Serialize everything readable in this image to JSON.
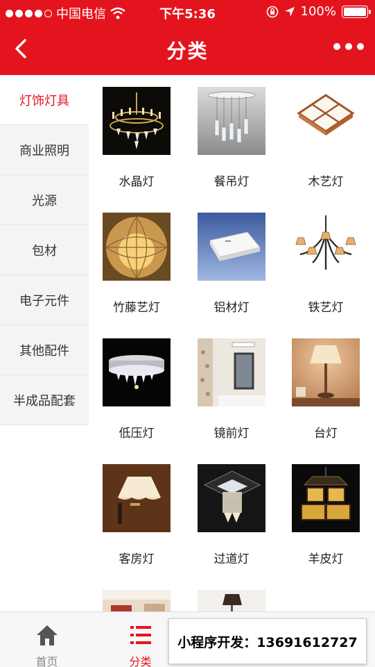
{
  "status_bar": {
    "carrier": "中国电信",
    "time": "下午5:36",
    "battery": "100%",
    "signal_dots": 5
  },
  "nav": {
    "title": "分类",
    "back_icon": "chevron-left-icon",
    "more_icon": "more-dots-icon"
  },
  "sidebar": {
    "items": [
      {
        "label": "灯饰灯具",
        "active": true
      },
      {
        "label": "商业照明",
        "active": false
      },
      {
        "label": "光源",
        "active": false
      },
      {
        "label": "包材",
        "active": false
      },
      {
        "label": "电子元件",
        "active": false
      },
      {
        "label": "其他配件",
        "active": false
      },
      {
        "label": "半成品配套",
        "active": false
      }
    ]
  },
  "products": [
    {
      "label": "水晶灯",
      "icon": "crystal-chandelier-image"
    },
    {
      "label": "餐吊灯",
      "icon": "dining-pendant-image"
    },
    {
      "label": "木艺灯",
      "icon": "wood-ceiling-lamp-image"
    },
    {
      "label": "竹藤艺灯",
      "icon": "rattan-lamp-image"
    },
    {
      "label": "铝材灯",
      "icon": "aluminum-panel-image"
    },
    {
      "label": "铁艺灯",
      "icon": "iron-chandelier-image"
    },
    {
      "label": "低压灯",
      "icon": "crystal-ceiling-image"
    },
    {
      "label": "镜前灯",
      "icon": "mirror-light-image"
    },
    {
      "label": "台灯",
      "icon": "table-lamp-image"
    },
    {
      "label": "客房灯",
      "icon": "wall-sconce-image"
    },
    {
      "label": "过道灯",
      "icon": "aisle-light-image"
    },
    {
      "label": "羊皮灯",
      "icon": "parchment-lamp-image"
    },
    {
      "label": "",
      "icon": "room-interior-image"
    },
    {
      "label": "",
      "icon": "floor-lamp-image"
    }
  ],
  "tabbar": {
    "tabs": [
      {
        "label": "首页",
        "icon": "home-icon",
        "active": false
      },
      {
        "label": "分类",
        "icon": "list-icon",
        "active": true
      },
      {
        "label": "",
        "icon": "",
        "active": false
      },
      {
        "label": "",
        "icon": "",
        "active": false
      }
    ]
  },
  "promo": {
    "text": "小程序开发：13691612727"
  },
  "colors": {
    "brand": "#e4141f",
    "sidebar_bg": "#f4f4f4"
  }
}
